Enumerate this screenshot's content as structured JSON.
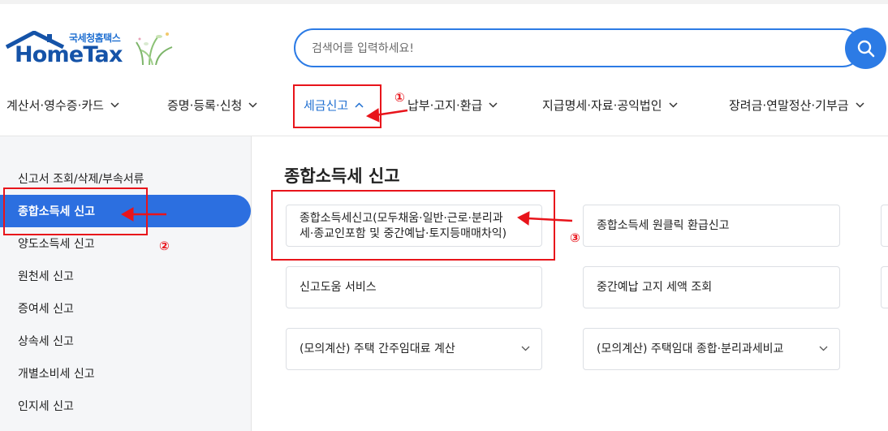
{
  "logo": {
    "sub_label": "국세청홈택스",
    "main_label": "HomeTax"
  },
  "search": {
    "placeholder": "검색어를 입력하세요!"
  },
  "nav": {
    "items": [
      {
        "label": "계산서·영수증·카드"
      },
      {
        "label": "증명·등록·신청"
      },
      {
        "label": "세금신고"
      },
      {
        "label": "납부·고지·환급"
      },
      {
        "label": "지급명세·자료·공익법인"
      },
      {
        "label": "장려금·연말정산·기부금"
      }
    ],
    "active_index": 2
  },
  "sidebar": {
    "items": [
      {
        "label": "신고서 조회/삭제/부속서류"
      },
      {
        "label": "종합소득세 신고"
      },
      {
        "label": "양도소득세 신고"
      },
      {
        "label": "원천세 신고"
      },
      {
        "label": "증여세 신고"
      },
      {
        "label": "상속세 신고"
      },
      {
        "label": "개별소비세 신고"
      },
      {
        "label": "인지세 신고"
      }
    ],
    "active_index": 1
  },
  "main": {
    "title": "종합소득세 신고",
    "cards": [
      {
        "line1": "종합소득세신고(모두채움·일반·근로·분리과",
        "line2": "세·종교인포함 및 중간예납·토지등매매차익)"
      },
      {
        "line1": "종합소득세 원클릭 환급신고"
      },
      {
        "line1": "신고도움 서비스"
      },
      {
        "line1": "중간예납 고지 세액 조회"
      },
      {
        "line1": "(모의계산) 주택 간주임대료 계산"
      },
      {
        "line1": "(모의계산) 주택임대 종합·분리과세비교"
      }
    ]
  },
  "annotations": {
    "markers": [
      "①",
      "②",
      "③"
    ],
    "color": "#e8141b"
  },
  "colors": {
    "accent": "#2c7be5",
    "brand": "#1553a8",
    "annotation": "#e8141b"
  },
  "icons": [
    "search-icon",
    "chevron-down-icon",
    "chevron-up-icon",
    "house-roof-icon",
    "grass-icon"
  ]
}
